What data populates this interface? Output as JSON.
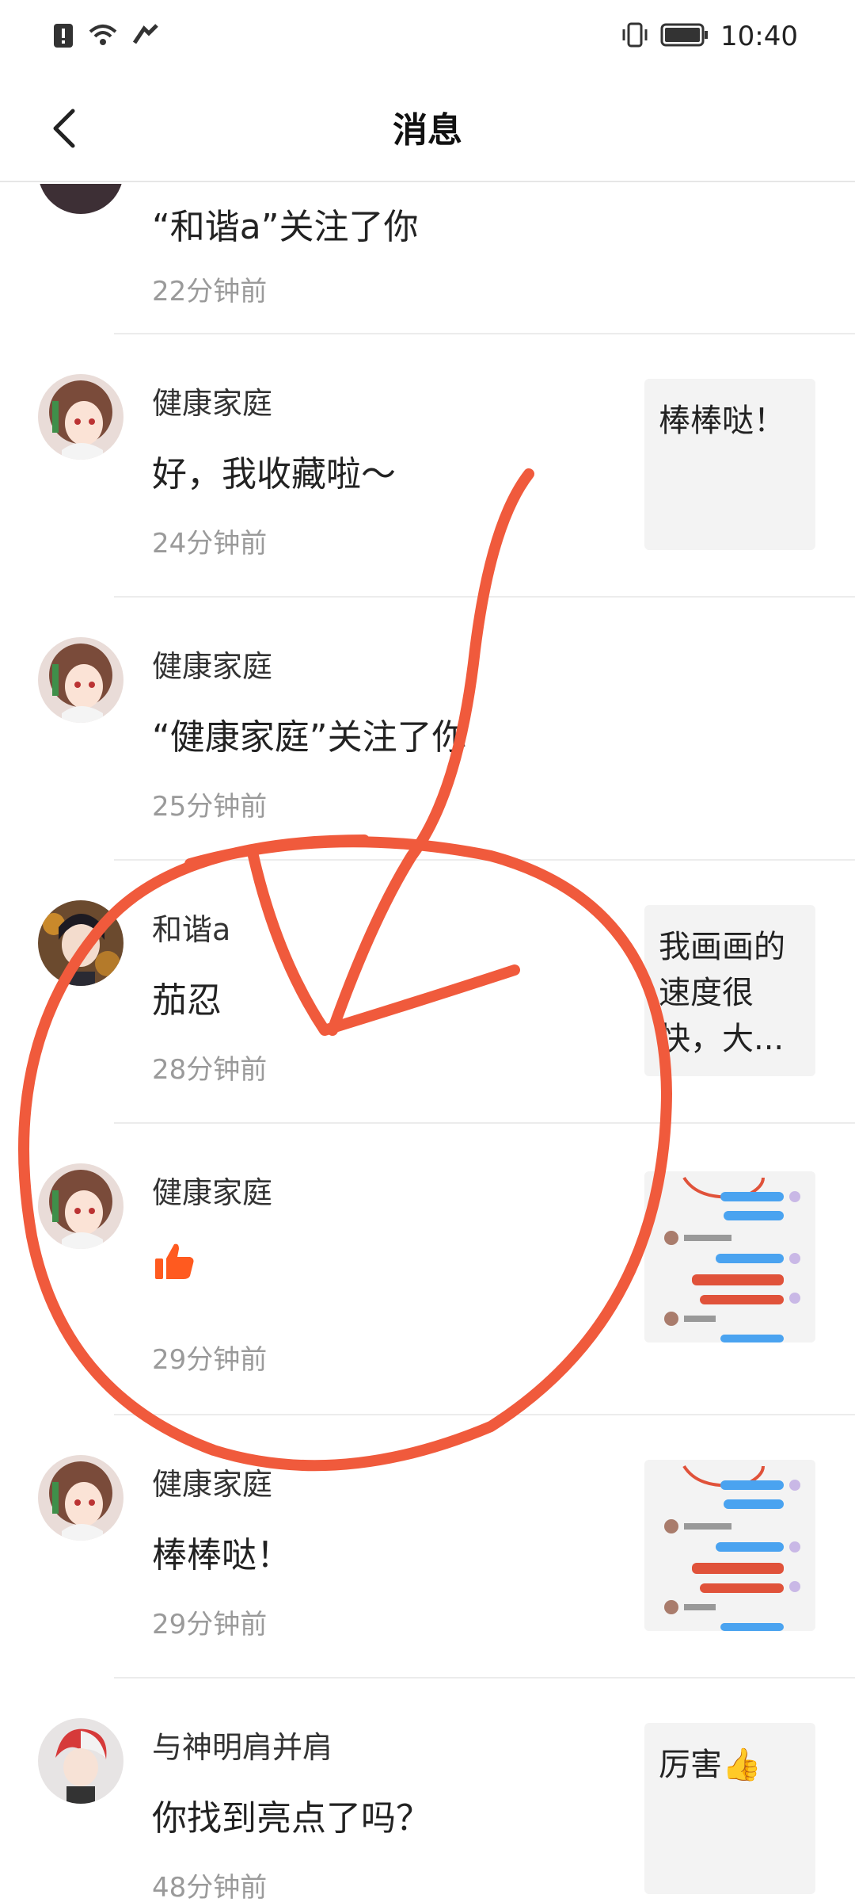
{
  "status_bar": {
    "time": "10:40"
  },
  "header": {
    "title": "消息"
  },
  "messages": [
    {
      "name": "",
      "content": "“和谐a”关注了你",
      "time": "22分钟前",
      "thumb_text": ""
    },
    {
      "name": "健康家庭",
      "content": "好，我收藏啦～",
      "time": "24分钟前",
      "thumb_text": "棒棒哒！"
    },
    {
      "name": "健康家庭",
      "content": "“健康家庭”关注了你",
      "time": "25分钟前",
      "thumb_text": ""
    },
    {
      "name": "和谐a",
      "content": "茄忍",
      "time": "28分钟前",
      "thumb_text": "我画画的速度很快，大..."
    },
    {
      "name": "健康家庭",
      "content": "",
      "time": "29分钟前",
      "thumb_text": ""
    },
    {
      "name": "健康家庭",
      "content": "棒棒哒！",
      "time": "29分钟前",
      "thumb_text": ""
    },
    {
      "name": "与神明肩并肩",
      "content": "你找到亮点了吗？",
      "time": "48分钟前",
      "thumb_text": "厉害👍"
    }
  ],
  "colors": {
    "accent_annotation": "#f05a3c",
    "thumb_up": "#ff5a1f"
  }
}
